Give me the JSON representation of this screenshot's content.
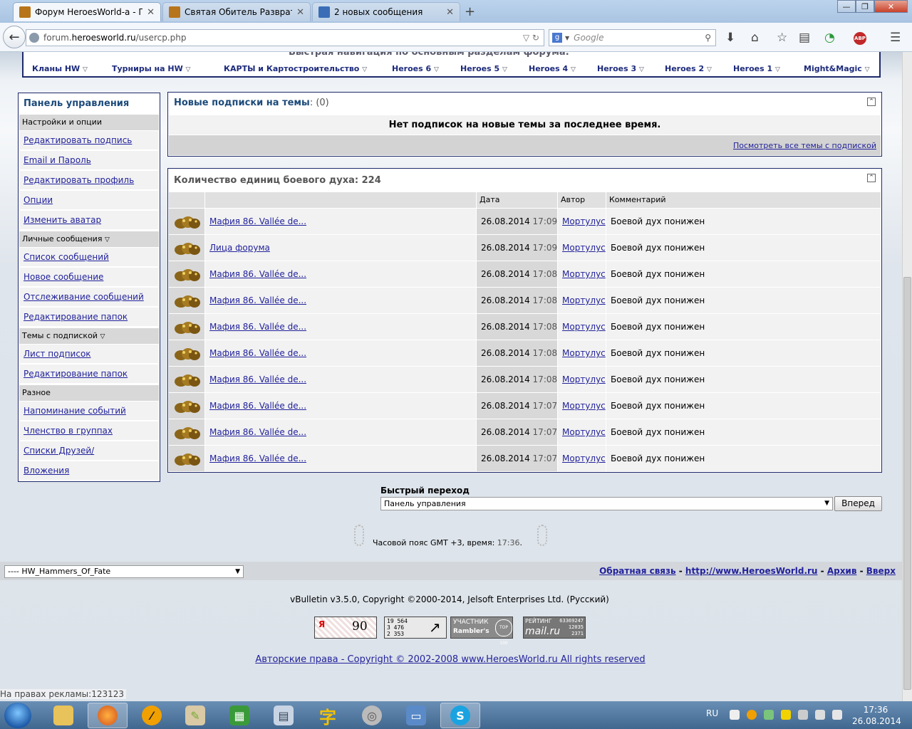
{
  "browser": {
    "tabs": [
      {
        "label": "Форум HeroesWorld-а - П...",
        "active": true
      },
      {
        "label": "Святая Обитель Разврата ...",
        "active": false
      },
      {
        "label": "2 новых сообщения",
        "active": false
      }
    ],
    "tab_close": "✕",
    "new_tab": "+",
    "window": {
      "minimize": "—",
      "maximize": "❐",
      "close": "✕"
    },
    "url_prefix": "forum.",
    "url_host": "heroesworld.ru",
    "url_path": "/usercp.php",
    "url_controls": "▽ ↻",
    "search_placeholder": "Google",
    "search_engine_icon": "g",
    "icons": {
      "downloads": "⬇",
      "home": "⌂",
      "bookmark": "☆",
      "reader": "▤",
      "sync": "◔",
      "adblock": "ABP",
      "menu": "☰"
    }
  },
  "quick_nav": {
    "title": "Быстрая навигация по основным разделам форума:",
    "items": [
      "Кланы HW",
      "Турниры на HW",
      "КАРТЫ и Картостроительство",
      "Heroes 6",
      "Heroes 5",
      "Heroes 4",
      "Heroes 3",
      "Heroes 2",
      "Heroes 1",
      "Might&Magic"
    ],
    "dropdown_glyph": "▽"
  },
  "sidebar": {
    "title": "Панель управления",
    "sections": [
      {
        "heading": "Настройки и опции",
        "items": [
          "Редактировать подпись",
          "Email и Пароль",
          "Редактировать профиль",
          "Опции",
          "Изменить аватар"
        ]
      },
      {
        "heading": "Личные сообщения",
        "items": [
          "Список сообщений",
          "Новое сообщение",
          "Отслеживание сообщений",
          "Редактирование папок"
        ]
      },
      {
        "heading": "Темы с подпиской",
        "items": [
          "Лист подписок",
          "Редактирование папок"
        ]
      },
      {
        "heading": "Разное",
        "items": [
          "Напоминание событий",
          "Членство в группах",
          "Списки Друзей/Игнорирования",
          "Вложения"
        ]
      }
    ]
  },
  "subscriptions": {
    "title": "Новые подписки на темы",
    "count": ": (0)",
    "empty_message": "Нет подписок на новые темы за последнее время.",
    "view_all_link": "Посмотреть все темы с подпиской",
    "collapse_glyph": "⌃"
  },
  "morale": {
    "title": "Количество единиц боевого духа: 224",
    "columns": {
      "icon": "",
      "thread": "",
      "date": "Дата",
      "author": "Автор",
      "comment": "Комментарий"
    },
    "rows": [
      {
        "thread": "Мафия 86. Vallée de...",
        "date": "26.08.2014",
        "time": "17:09",
        "author": "Мортулус",
        "comment": "Боевой дух понижен"
      },
      {
        "thread": "Лица форума",
        "date": "26.08.2014",
        "time": "17:09",
        "author": "Мортулус",
        "comment": "Боевой дух понижен"
      },
      {
        "thread": "Мафия 86. Vallée de...",
        "date": "26.08.2014",
        "time": "17:08",
        "author": "Мортулус",
        "comment": "Боевой дух понижен"
      },
      {
        "thread": "Мафия 86. Vallée de...",
        "date": "26.08.2014",
        "time": "17:08",
        "author": "Мортулус",
        "comment": "Боевой дух понижен"
      },
      {
        "thread": "Мафия 86. Vallée de...",
        "date": "26.08.2014",
        "time": "17:08",
        "author": "Мортулус",
        "comment": "Боевой дух понижен"
      },
      {
        "thread": "Мафия 86. Vallée de...",
        "date": "26.08.2014",
        "time": "17:08",
        "author": "Мортулус",
        "comment": "Боевой дух понижен"
      },
      {
        "thread": "Мафия 86. Vallée de...",
        "date": "26.08.2014",
        "time": "17:08",
        "author": "Мортулус",
        "comment": "Боевой дух понижен"
      },
      {
        "thread": "Мафия 86. Vallée de...",
        "date": "26.08.2014",
        "time": "17:07",
        "author": "Мортулус",
        "comment": "Боевой дух понижен"
      },
      {
        "thread": "Мафия 86. Vallée de...",
        "date": "26.08.2014",
        "time": "17:07",
        "author": "Мортулус",
        "comment": "Боевой дух понижен"
      },
      {
        "thread": "Мафия 86. Vallée de...",
        "date": "26.08.2014",
        "time": "17:07",
        "author": "Мортулус",
        "comment": "Боевой дух понижен"
      }
    ]
  },
  "quick_jump": {
    "label": "Быстрый переход",
    "selected": "Панель управления",
    "go_label": "Вперед",
    "arrow": "▼"
  },
  "timezone": {
    "text": "Часовой пояс GMT +3, время:",
    "time": "17:36",
    "dot": "."
  },
  "footer": {
    "style_selected": "---- HW_Hammers_Of_Fate",
    "links": [
      "Обратная связь",
      "http://www.HeroesWorld.ru",
      "Архив",
      "Вверх"
    ],
    "separator": " - ",
    "vbulletin": "vBulletin v3.5.0, Copyright ©2000-2014, Jelsoft Enterprises Ltd. (Русский)",
    "counters": {
      "yandex": {
        "letter": "Я",
        "value": "90"
      },
      "hits": [
        "19 564",
        "3 476",
        "2 353"
      ],
      "rambler": {
        "line1": "УЧАСТНИК",
        "line2": "Rambler's",
        "badge": "TOP 100"
      },
      "mailru": {
        "label": "РЕЙТИНГ",
        "brand": "mail.ru",
        "values": [
          "63369247",
          "12035",
          "2371"
        ]
      }
    },
    "copyright": "Авторские права - Copyright © 2002-2008 www.HeroesWorld.ru All rights reserved",
    "status": "На правах рекламы:123123"
  },
  "taskbar": {
    "lang": "RU",
    "time": "17:36",
    "date": "26.08.2014",
    "apps": [
      "explorer",
      "firefox",
      "pencil",
      "paint",
      "rubik-cube",
      "calculator",
      "ime-char",
      "disc",
      "monitor",
      "skype"
    ],
    "app_glyphs": {
      "pencil": "⁄",
      "ime-char": "字",
      "skype": "S",
      "rubik-cube": "▦",
      "calculator": "▤",
      "monitor": "▭",
      "disc": "◎",
      "paint": "✎"
    }
  },
  "colors": {
    "link": "#22229c",
    "border": "#1f2a6b",
    "title": "#1c4a7a"
  }
}
